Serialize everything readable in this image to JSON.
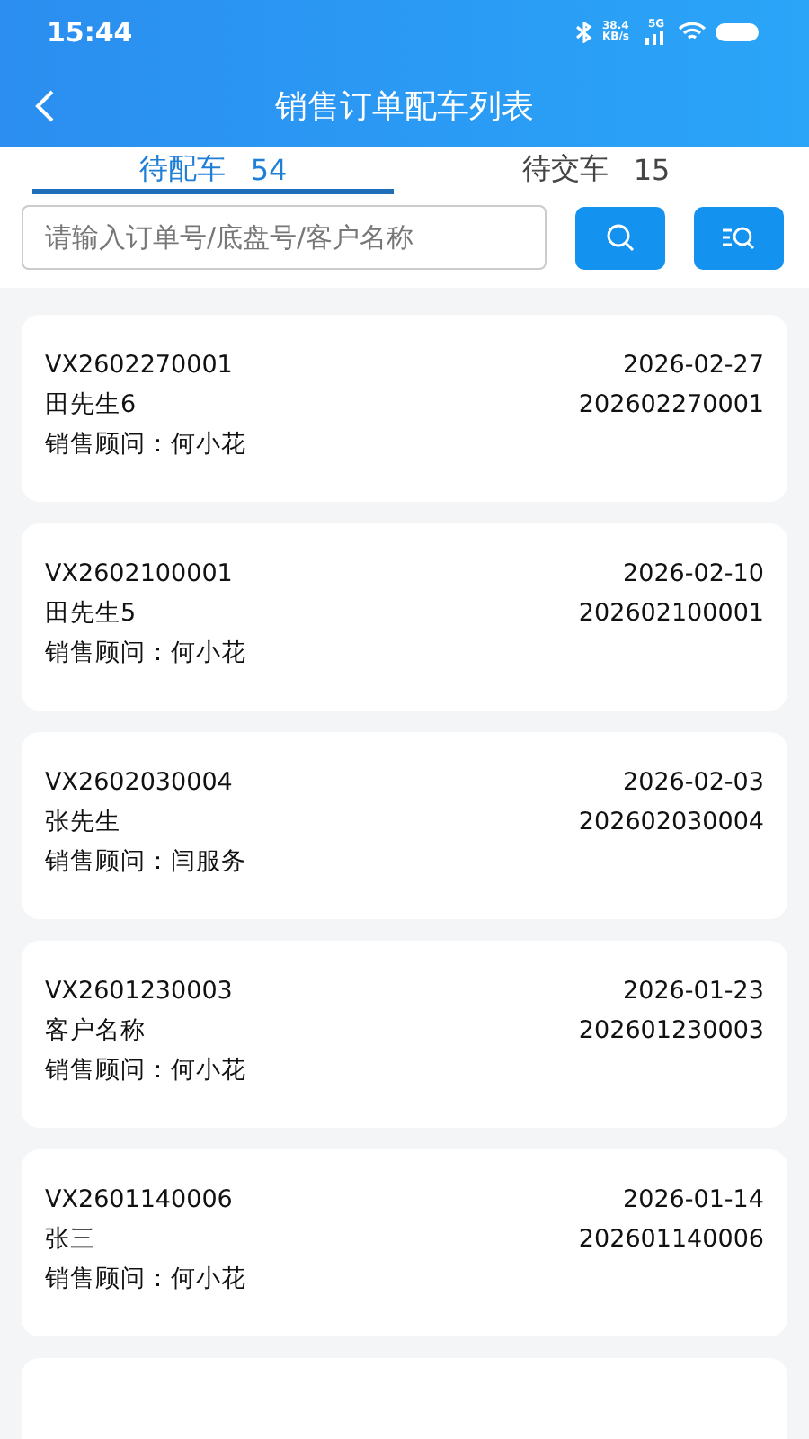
{
  "status_bar": {
    "time": "15:44",
    "speed": "38.4 KB/s",
    "network": "5G"
  },
  "header": {
    "title": "销售订单配车列表"
  },
  "tabs": [
    {
      "label": "待配车",
      "count": "54",
      "selected": true
    },
    {
      "label": "待交车",
      "count": "15",
      "selected": false
    }
  ],
  "search": {
    "placeholder": "请输入订单号/底盘号/客户名称"
  },
  "orders": [
    {
      "order_no": "VX2602270001",
      "date": "2026-02-27",
      "customer": "田先生6",
      "code": "202602270001",
      "advisor": "销售顾问：何小花"
    },
    {
      "order_no": "VX2602100001",
      "date": "2026-02-10",
      "customer": "田先生5",
      "code": "202602100001",
      "advisor": "销售顾问：何小花"
    },
    {
      "order_no": "VX2602030004",
      "date": "2026-02-03",
      "customer": "张先生",
      "code": "202602030004",
      "advisor": "销售顾问：闫服务"
    },
    {
      "order_no": "VX2601230003",
      "date": "2026-01-23",
      "customer": "客户名称",
      "code": "202601230003",
      "advisor": "销售顾问：何小花"
    },
    {
      "order_no": "VX2601140006",
      "date": "2026-01-14",
      "customer": "张三",
      "code": "202601140006",
      "advisor": "销售顾问：何小花"
    }
  ]
}
